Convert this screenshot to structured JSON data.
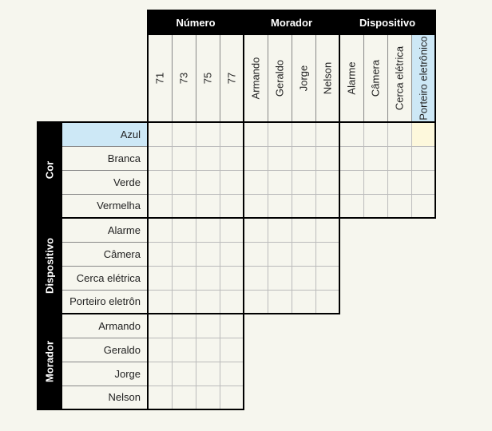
{
  "colGroups": [
    {
      "name": "Número",
      "items": [
        "71",
        "73",
        "75",
        "77"
      ]
    },
    {
      "name": "Morador",
      "items": [
        "Armando",
        "Geraldo",
        "Jorge",
        "Nelson"
      ]
    },
    {
      "name": "Dispositivo",
      "items": [
        "Alarme",
        "Câmera",
        "Cerca elétrica",
        "Porteiro eletrônico"
      ]
    }
  ],
  "rowGroups": [
    {
      "name": "Cor",
      "items": [
        "Azul",
        "Branca",
        "Verde",
        "Vermelha"
      ],
      "colSpan": 3
    },
    {
      "name": "Dispositivo",
      "items": [
        "Alarme",
        "Câmera",
        "Cerca elétrica",
        "Porteiro eletrôn"
      ],
      "colSpan": 2
    },
    {
      "name": "Morador",
      "items": [
        "Armando",
        "Geraldo",
        "Jorge",
        "Nelson"
      ],
      "colSpan": 1
    }
  ],
  "highlights": {
    "col": {
      "group": 2,
      "item": 3,
      "style": "hl-blue"
    },
    "row": {
      "group": 0,
      "item": 0,
      "style": "hl-blue"
    },
    "intersect": {
      "rowGroup": 0,
      "rowItem": 0,
      "colGroup": 2,
      "colItem": 3,
      "style": "hl-yellow"
    }
  }
}
